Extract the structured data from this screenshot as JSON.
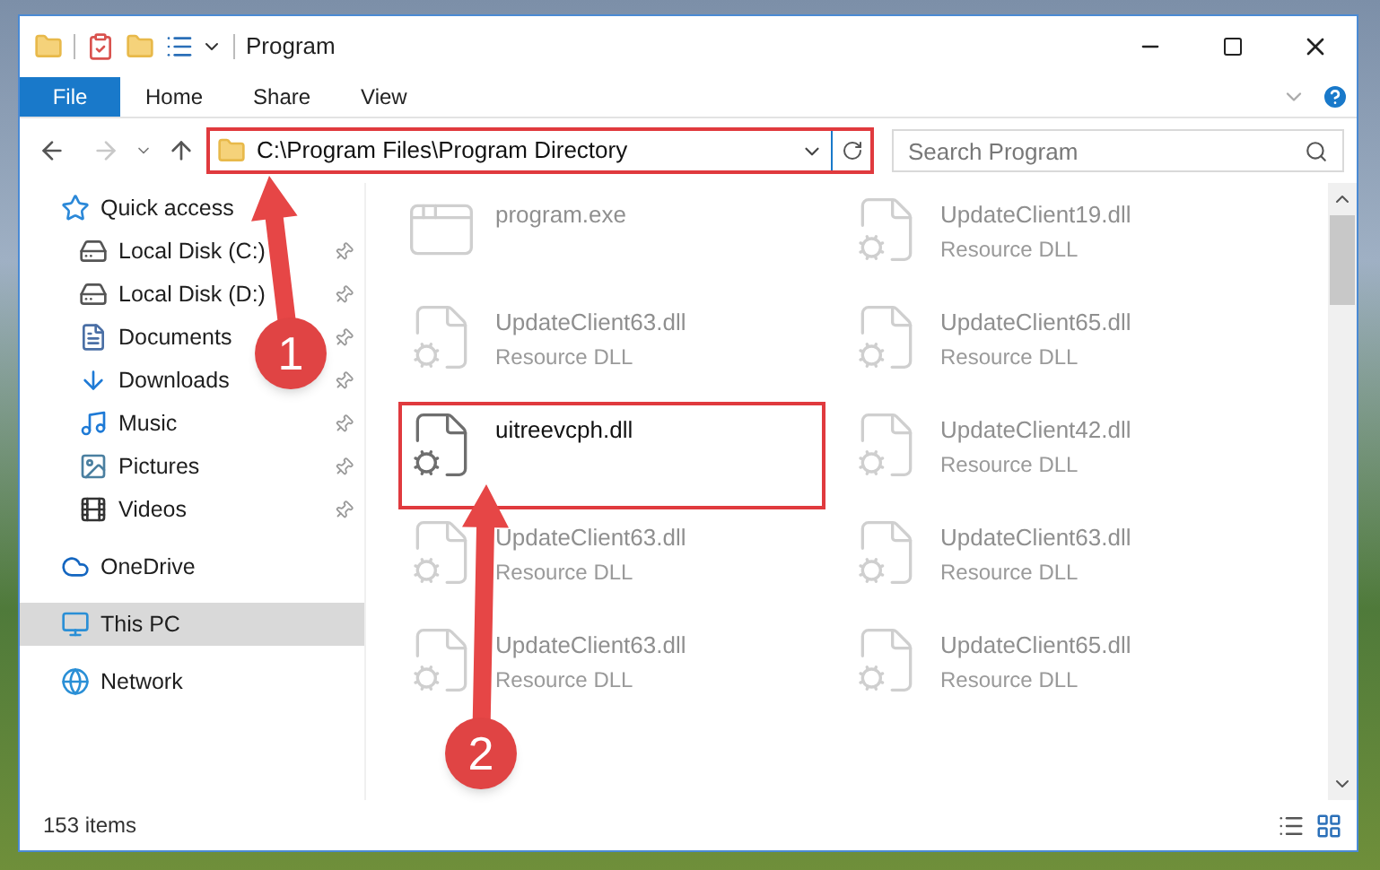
{
  "window": {
    "title": "Program"
  },
  "ribbon": {
    "tabs": [
      {
        "label": "File",
        "kind": "file"
      },
      {
        "label": "Home",
        "kind": "tab"
      },
      {
        "label": "Share",
        "kind": "tab"
      },
      {
        "label": "View",
        "kind": "tab"
      }
    ]
  },
  "address": {
    "path": "C:\\Program Files\\Program Directory",
    "highlighted": true
  },
  "search": {
    "placeholder": "Search Program"
  },
  "sidebar": {
    "items": [
      {
        "label": "Quick access",
        "selected": false,
        "children": [
          {
            "label": "Local Disk (C:)",
            "pinned": true,
            "selected": false
          },
          {
            "label": "Local Disk (D:)",
            "pinned": true,
            "selected": false
          },
          {
            "label": "Documents",
            "pinned": true,
            "selected": false
          },
          {
            "label": "Downloads",
            "pinned": true,
            "selected": false
          },
          {
            "label": "Music",
            "pinned": true,
            "selected": false
          },
          {
            "label": "Pictures",
            "pinned": true,
            "selected": false
          },
          {
            "label": "Videos",
            "pinned": true,
            "selected": false
          }
        ]
      },
      {
        "label": "OneDrive",
        "selected": false
      },
      {
        "label": "This PC",
        "selected": true
      },
      {
        "label": "Network",
        "selected": false
      }
    ]
  },
  "files": [
    {
      "name": "program.exe",
      "kind": "exe",
      "blurred": true,
      "highlighted": false
    },
    {
      "name": "UpdateClient19.dll",
      "type": "Resource DLL",
      "kind": "dll",
      "blurred": true,
      "highlighted": false
    },
    {
      "name": "UpdateClient63.dll",
      "type": "Resource DLL",
      "kind": "dll",
      "blurred": true,
      "highlighted": false
    },
    {
      "name": "UpdateClient65.dll",
      "type": "Resource DLL",
      "kind": "dll",
      "blurred": true,
      "highlighted": false
    },
    {
      "name": "uitreevcph.dll",
      "kind": "dll",
      "blurred": false,
      "highlighted": true
    },
    {
      "name": "UpdateClient42.dll",
      "type": "Resource DLL",
      "kind": "dll",
      "blurred": true,
      "highlighted": false
    },
    {
      "name": "UpdateClient63.dll",
      "type": "Resource DLL",
      "kind": "dll",
      "blurred": true,
      "highlighted": false
    },
    {
      "name": "UpdateClient63.dll",
      "type": "Resource DLL",
      "kind": "dll",
      "blurred": true,
      "highlighted": false
    },
    {
      "name": "UpdateClient63.dll",
      "type": "Resource DLL",
      "kind": "dll",
      "blurred": true,
      "highlighted": false
    },
    {
      "name": "UpdateClient65.dll",
      "type": "Resource DLL",
      "kind": "dll",
      "blurred": true,
      "highlighted": false
    }
  ],
  "status_bar": {
    "item_count": "153 items"
  },
  "annotations": [
    {
      "number": "1"
    },
    {
      "number": "2"
    }
  ]
}
